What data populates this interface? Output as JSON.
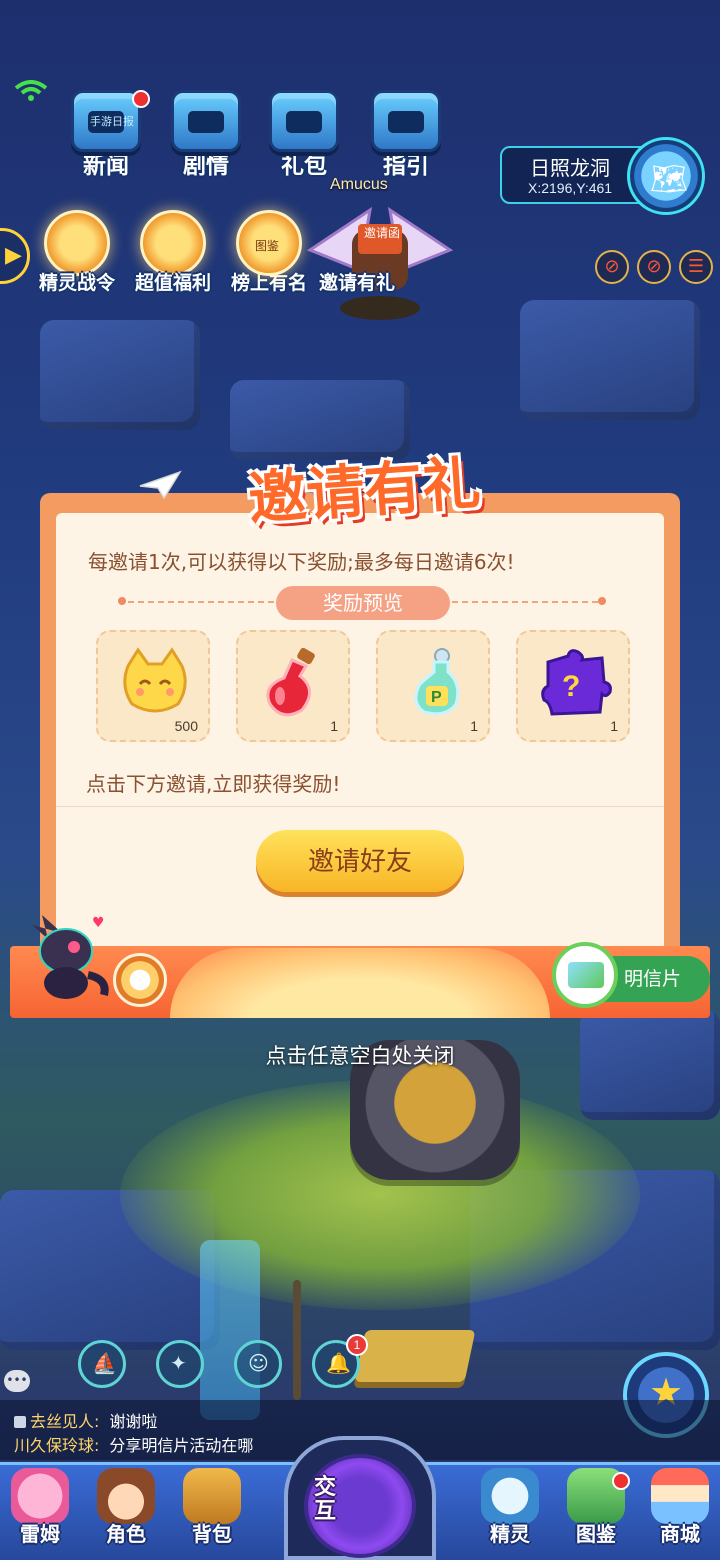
{
  "top_menu": {
    "items": [
      {
        "label": "新闻",
        "icon": "newspaper-icon"
      },
      {
        "label": "剧情",
        "icon": "story-icon"
      },
      {
        "label": "礼包",
        "icon": "gift-pack-icon"
      },
      {
        "label": "指引",
        "icon": "guide-icon"
      }
    ],
    "news_screen_text": "手游日报"
  },
  "location": {
    "name": "日照龙洞",
    "coords": "X:2196,Y:461"
  },
  "events": {
    "items": [
      {
        "label": "精灵战令",
        "icon": "battle-pass-icon"
      },
      {
        "label": "超值福利",
        "icon": "welfare-gift-icon"
      },
      {
        "label": "榜上有名",
        "icon": "leaderboard-trophy-icon",
        "icon_text": "图鉴"
      },
      {
        "label": "邀请有礼",
        "icon": "invite-gift-icon",
        "icon_text": "邀请函"
      }
    ]
  },
  "player": {
    "name": "Amucus"
  },
  "invite_dialog": {
    "title": "邀请有礼",
    "description": "每邀请1次,可以获得以下奖励;最多每日邀请6次!",
    "preview_label": "奖励预览",
    "rewards": [
      {
        "icon": "cat-coin-icon",
        "qty": "500"
      },
      {
        "icon": "red-potion-icon",
        "qty": "1"
      },
      {
        "icon": "p-potion-icon",
        "qty": "1"
      },
      {
        "icon": "mystery-puzzle-icon",
        "qty": "1"
      }
    ],
    "hint": "点击下方邀请,立即获得奖励!",
    "invite_button": "邀请好友",
    "postcard_label": "明信片"
  },
  "close_hint": "点击任意空白处关闭",
  "quick_actions": {
    "bell_badge": "1"
  },
  "chat": {
    "messages": [
      {
        "sender": "去丝见人:",
        "text": "谢谢啦"
      },
      {
        "sender": "川久保玲球:",
        "text": "分享明信片活动在哪"
      }
    ]
  },
  "bottom_nav": {
    "left": [
      {
        "label": "雷姆",
        "icon": "lemu-icon"
      },
      {
        "label": "角色",
        "icon": "character-icon"
      },
      {
        "label": "背包",
        "icon": "backpack-icon"
      }
    ],
    "center": "交互",
    "right": [
      {
        "label": "精灵",
        "icon": "spirit-icon"
      },
      {
        "label": "图鉴",
        "icon": "handbook-icon"
      },
      {
        "label": "商城",
        "icon": "shop-icon"
      }
    ]
  },
  "colors": {
    "dialog_accent": "#ff6a2a",
    "dialog_bg": "#fdf4e6",
    "invite_button": "#f8b526",
    "postcard_green": "#34a454"
  }
}
